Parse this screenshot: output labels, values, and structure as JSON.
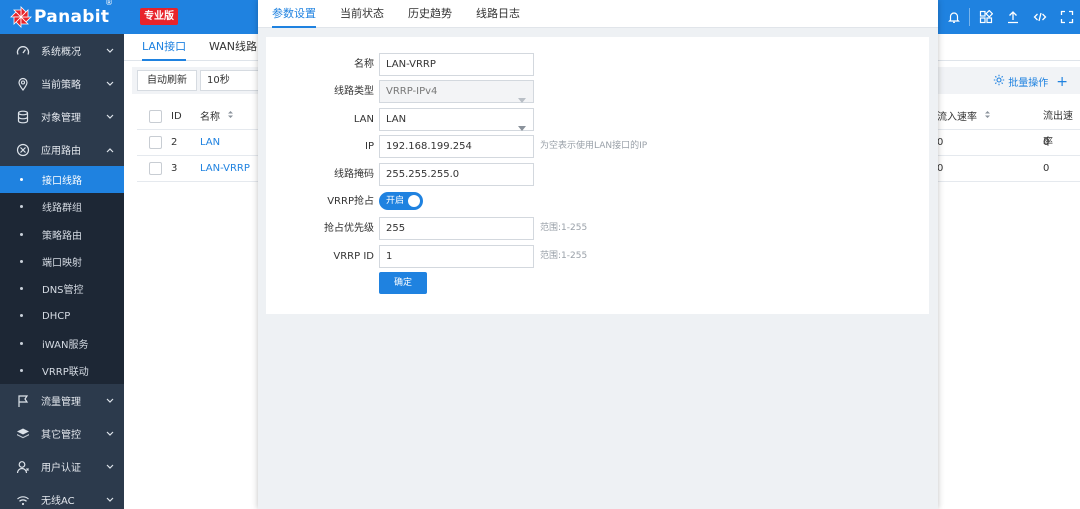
{
  "header": {
    "brand": "Panabit",
    "reg_mark": "®",
    "edition_badge": "专业版",
    "accent": "#1f82e0",
    "badge_color": "#e8232a",
    "icons": [
      "dashboard-icon",
      "bell-icon",
      "apps-grid-icon",
      "upload-icon",
      "code-icon",
      "fullscreen-icon"
    ]
  },
  "sidebar": {
    "items": [
      {
        "label": "系统概况",
        "icon": "dashboard-icon"
      },
      {
        "label": "当前策略",
        "icon": "location-pin-icon"
      },
      {
        "label": "对象管理",
        "icon": "database-icon"
      },
      {
        "label": "应用路由",
        "icon": "route-icon",
        "expanded": true
      }
    ],
    "sub_items": [
      "接口线路",
      "线路群组",
      "策略路由",
      "端口映射",
      "DNS管控",
      "DHCP",
      "iWAN服务",
      "VRRP联动"
    ],
    "active_sub": "接口线路",
    "items_after": [
      {
        "label": "流量管理",
        "icon": "flag-icon"
      },
      {
        "label": "其它管控",
        "icon": "layers-icon"
      },
      {
        "label": "用户认证",
        "icon": "user-icon"
      },
      {
        "label": "无线AC",
        "icon": "wifi-icon"
      }
    ]
  },
  "main": {
    "tabs": [
      "LAN接口",
      "WAN线路"
    ],
    "active_tab": "LAN接口",
    "auto_refresh_label": "自动刷新",
    "refresh_interval": "10秒",
    "batch_label": "批量操作",
    "table": {
      "headers": {
        "id": "ID",
        "name": "名称",
        "in_rate": "流入速率",
        "out_rate": "流出速率"
      },
      "rows": [
        {
          "id": "2",
          "name": "LAN",
          "in_rate": "0",
          "out_rate": "0"
        },
        {
          "id": "3",
          "name": "LAN-VRRP",
          "in_rate": "0",
          "out_rate": "0"
        }
      ]
    }
  },
  "modal": {
    "tabs": [
      "参数设置",
      "当前状态",
      "历史趋势",
      "线路日志"
    ],
    "active_tab": "参数设置",
    "form": {
      "name_label": "名称",
      "name_value": "LAN-VRRP",
      "type_label": "线路类型",
      "type_value": "VRRP-IPv4",
      "lan_label": "LAN",
      "lan_value": "LAN",
      "ip_label": "IP",
      "ip_value": "192.168.199.254",
      "ip_hint": "为空表示使用LAN接口的IP",
      "mask_label": "线路掩码",
      "mask_value": "255.255.255.0",
      "preempt_label": "VRRP抢占",
      "preempt_value": "开启",
      "priority_label": "抢占优先级",
      "priority_value": "255",
      "priority_hint": "范围:1-255",
      "vrid_label": "VRRP ID",
      "vrid_value": "1",
      "vrid_hint": "范围:1-255",
      "confirm_label": "确定"
    }
  }
}
